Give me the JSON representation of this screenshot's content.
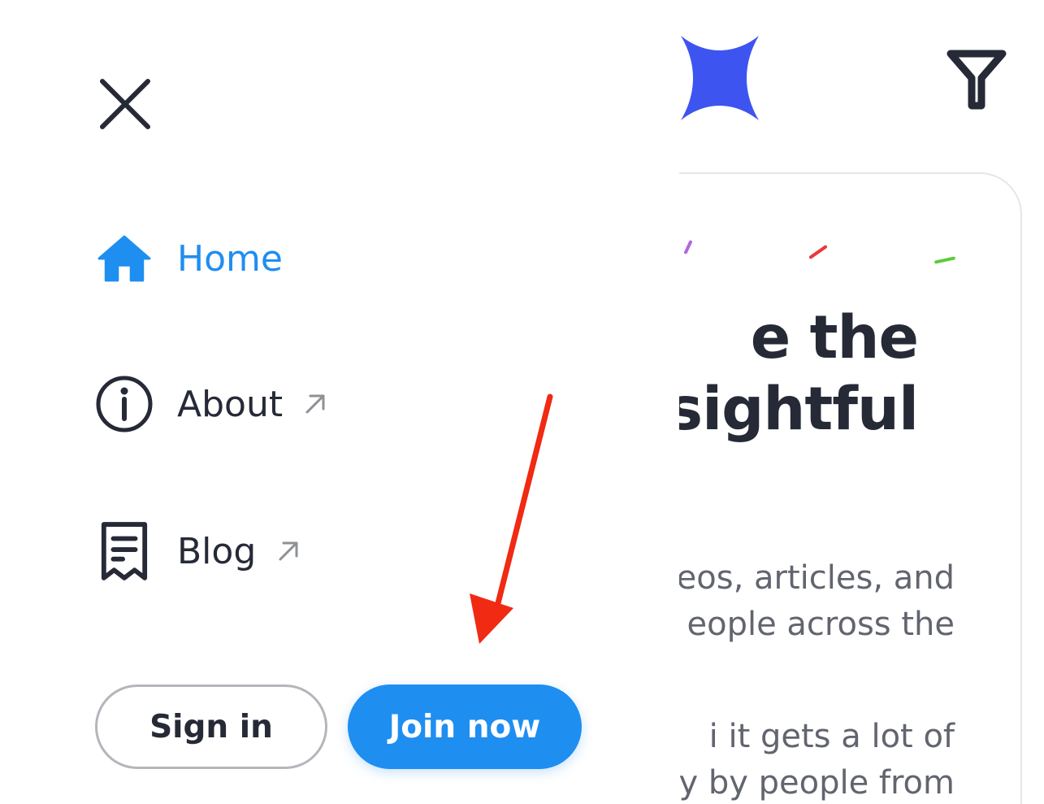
{
  "background_page": {
    "hero_heading_lines": [
      "e the",
      "sightful"
    ],
    "hero_paragraph_1": [
      "eos, articles, and",
      "eople across the"
    ],
    "hero_paragraph_2": [
      "i it gets a lot of",
      "ly by people from"
    ],
    "confetti_colors": [
      "#b266e0",
      "#e83a3a",
      "#5ccb3a"
    ],
    "logo_color": "#3e54f0",
    "filter_icon": "filter-icon"
  },
  "menu": {
    "close_icon": "close-icon",
    "items": [
      {
        "label": "Home",
        "icon": "home-icon",
        "active": true,
        "external": false
      },
      {
        "label": "About",
        "icon": "info-icon",
        "active": false,
        "external": true
      },
      {
        "label": "Blog",
        "icon": "receipt-icon",
        "active": false,
        "external": true
      }
    ],
    "sign_in_label": "Sign in",
    "join_now_label": "Join now"
  },
  "colors": {
    "accent": "#1f8ef1",
    "text_dark": "#262a37",
    "text_muted": "#62656f",
    "annotation": "#f02a13"
  }
}
